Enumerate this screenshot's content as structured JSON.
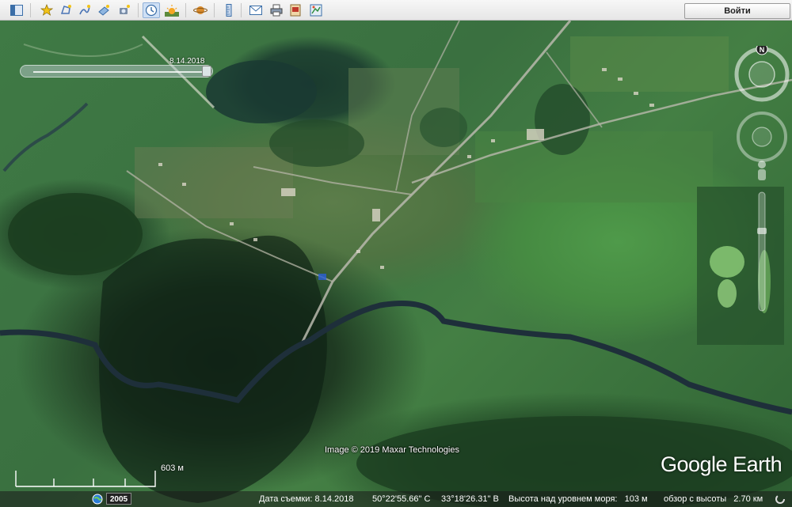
{
  "toolbar": {
    "buttons": [
      {
        "name": "sidebar-toggle-icon",
        "label": "sidebar"
      },
      {
        "name": "add-placemark-icon",
        "label": "placemark"
      },
      {
        "name": "add-polygon-icon",
        "label": "polygon"
      },
      {
        "name": "add-path-icon",
        "label": "path"
      },
      {
        "name": "image-overlay-icon",
        "label": "overlay"
      },
      {
        "name": "record-tour-icon",
        "label": "tour"
      },
      {
        "name": "historical-imagery-icon",
        "label": "history"
      },
      {
        "name": "sunlight-icon",
        "label": "sun"
      },
      {
        "name": "planets-icon",
        "label": "planets"
      },
      {
        "name": "ruler-icon",
        "label": "ruler"
      },
      {
        "name": "email-icon",
        "label": "email"
      },
      {
        "name": "print-icon",
        "label": "print"
      },
      {
        "name": "save-image-icon",
        "label": "save image"
      },
      {
        "name": "view-in-maps-icon",
        "label": "maps"
      }
    ],
    "signin_label": "Войти"
  },
  "time_slider": {
    "date_label": "8.14.2018",
    "position_fraction": 0.97
  },
  "map": {
    "copyright": "Image © 2019 Maxar Technologies",
    "logo": "Google Earth",
    "scale_label": "603 м",
    "compass_north": "N"
  },
  "statusbar": {
    "year_badge": "2005",
    "date_label": "Дата съемки: 8.14.2018",
    "latitude": "50°22'55.66\" С",
    "longitude": "33°18'26.31\" В",
    "elevation": "Высота над уровнем моря:   103 м",
    "eye_alt": "обзор с высоты   2.70 км"
  },
  "colors": {
    "toolbar_bg": "#eeeeee",
    "active_btn": "#cfe0f5",
    "river": "#1e2f3a"
  }
}
